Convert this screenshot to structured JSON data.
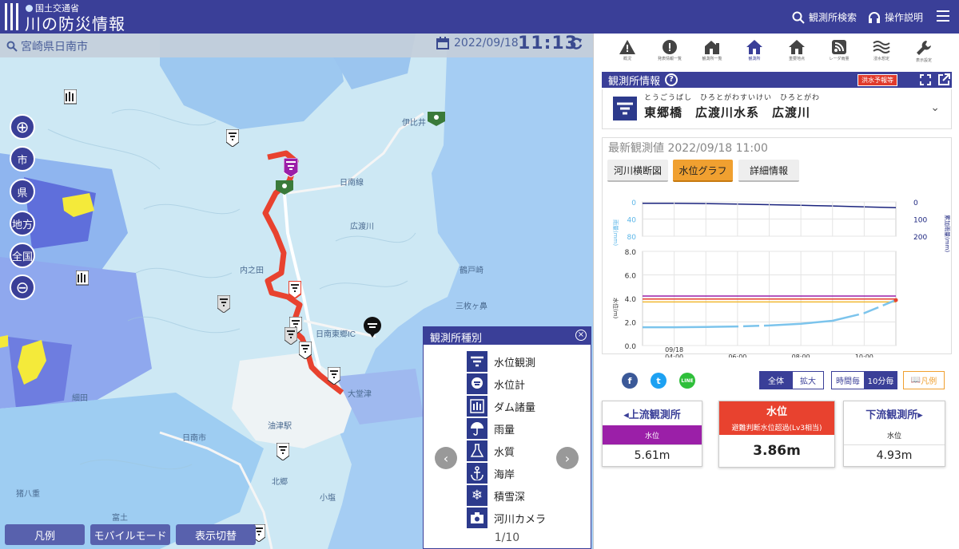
{
  "header": {
    "ministry": "国土交通省",
    "title": "川の防災情報",
    "search_label": "観測所検索",
    "help_label": "操作説明"
  },
  "map": {
    "location": "宮崎県日南市",
    "date": "2022/09/18",
    "time": "11:13",
    "zoom_buttons": [
      "市",
      "県",
      "地方",
      "全国"
    ],
    "bottom_buttons": [
      "凡例",
      "モバイルモード",
      "表示切替"
    ],
    "place_labels": [
      "日南市",
      "油津駅",
      "日南線",
      "広渡川",
      "伊比井",
      "内之田",
      "鶴戸崎",
      "三枚ヶ鼻",
      "日南東郷IC",
      "大堂津",
      "富土",
      "小塩",
      "細田",
      "北郷",
      "猪八重"
    ]
  },
  "legend": {
    "title": "観測所種別",
    "items": [
      "水位観測",
      "水位計",
      "ダム諸量",
      "雨量",
      "水質",
      "海岸",
      "積雪深",
      "河川カメラ"
    ],
    "page": "1/10"
  },
  "panel": {
    "tabs": [
      "概況",
      "発表情報一覧",
      "観測所一覧",
      "観測所",
      "重要地点",
      "レーダ雨量",
      "浸水想定",
      "表示設定"
    ],
    "info_title": "観測所情報",
    "flood_label": "洪水予報等",
    "station": {
      "ruby": "とうごうばし　ひろとがわすいけい　ひろとがわ",
      "name": "東郷橋　広渡川水系　広渡川"
    },
    "latest": "最新観測値 2022/09/18 11:00",
    "buttons": [
      "河川横断図",
      "水位グラフ",
      "詳細情報"
    ],
    "view_buttons": [
      "全体",
      "拡大"
    ],
    "interval_buttons": [
      "時間毎",
      "10分毎"
    ],
    "legend_btn": "凡例",
    "share": [
      "f",
      "t",
      "LINE"
    ]
  },
  "cards": {
    "up": {
      "title": "◂上流観測所",
      "sub": "水位",
      "value": "5.61m"
    },
    "mid": {
      "title": "水位",
      "sub": "避難判断水位超過(Lv3相当)",
      "value": "3.86m"
    },
    "down": {
      "title": "下流観測所▸",
      "sub": "水位",
      "value": "4.93m"
    }
  },
  "colors": {
    "header": "#3a3f98",
    "alert": "#e8422f",
    "upstream": "#9b1fa8",
    "selected": "#f0a030"
  },
  "chart_data": {
    "type": "line",
    "rain": {
      "ylabel": "雨量(mm)",
      "ylim": [
        0,
        80
      ],
      "yticks": [
        "0",
        "40",
        "80"
      ],
      "cum_ylabel": "累加雨量(mm)",
      "cum_yticks": [
        "0",
        "100",
        "200"
      ],
      "cumulative": {
        "x": [
          "03:00",
          "04:00",
          "05:00",
          "06:00",
          "07:00",
          "08:00",
          "09:00",
          "10:00",
          "11:00"
        ],
        "values": [
          8,
          8,
          10,
          13,
          16,
          20,
          24,
          29,
          34
        ]
      }
    },
    "level": {
      "ylabel": "水位(m)",
      "ylim": [
        0,
        8
      ],
      "yticks": [
        "0.0",
        "2.0",
        "4.0",
        "6.0",
        "8.0"
      ],
      "xticks": [
        "09/18\n04:00",
        "06:00",
        "08:00",
        "10:00"
      ],
      "thresholds": [
        {
          "name": "purple",
          "value": 4.2,
          "color": "#9b1fa8"
        },
        {
          "name": "red",
          "value": 3.95,
          "color": "#e8422f"
        },
        {
          "name": "yellow",
          "value": 3.7,
          "color": "#f0b830"
        }
      ],
      "series": {
        "x": [
          "03:00",
          "04:00",
          "05:00",
          "06:00",
          "07:00",
          "08:00",
          "09:00",
          "10:00",
          "11:00"
        ],
        "values": [
          1.55,
          1.55,
          1.58,
          1.62,
          1.7,
          1.85,
          2.1,
          2.75,
          3.86
        ]
      }
    }
  }
}
